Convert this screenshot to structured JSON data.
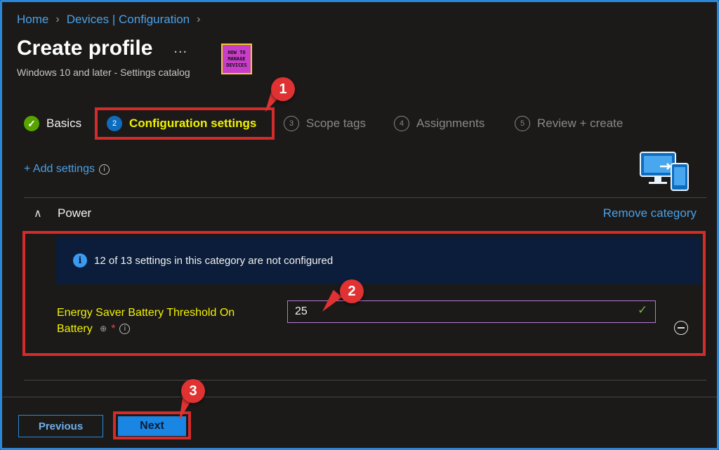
{
  "breadcrumb": {
    "home": "Home",
    "section": "Devices | Configuration"
  },
  "header": {
    "title": "Create profile",
    "more": "...",
    "subtitle": "Windows 10 and later - Settings catalog",
    "logo_lines": [
      "HOW TO",
      "MANAGE",
      "DEVICES"
    ]
  },
  "steps": [
    {
      "num": "✓",
      "label": "Basics",
      "state": "done"
    },
    {
      "num": "2",
      "label": "Configuration settings",
      "state": "active"
    },
    {
      "num": "3",
      "label": "Scope tags",
      "state": "todo"
    },
    {
      "num": "4",
      "label": "Assignments",
      "state": "todo"
    },
    {
      "num": "5",
      "label": "Review + create",
      "state": "todo"
    }
  ],
  "callouts": {
    "one": "1",
    "two": "2",
    "three": "3"
  },
  "add_settings": "+ Add settings",
  "category": {
    "name": "Power",
    "remove_label": "Remove category"
  },
  "notice": "12 of 13 settings in this category are not configured",
  "setting": {
    "label_line1": "Energy Saver Battery Threshold On",
    "label_line2": "Battery",
    "required_marker": "*",
    "value": "25"
  },
  "footer": {
    "previous": "Previous",
    "next": "Next"
  },
  "colors": {
    "accent": "#2b88d8",
    "highlight_text": "#f2f200",
    "callout": "#d42b2b"
  }
}
